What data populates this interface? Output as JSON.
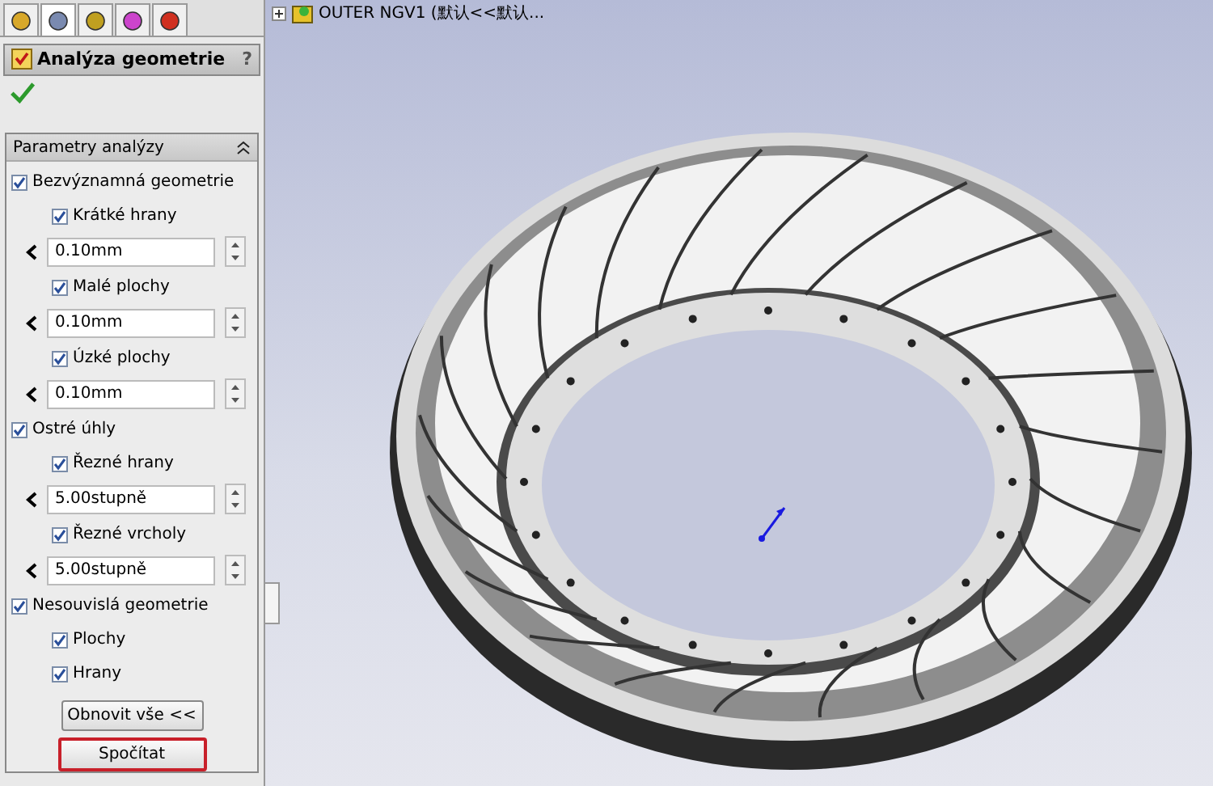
{
  "tabs": [
    {
      "selected": false
    },
    {
      "selected": true
    },
    {
      "selected": false
    },
    {
      "selected": false
    },
    {
      "selected": false
    }
  ],
  "tree": {
    "label": "OUTER NGV1 (默认<<默认..."
  },
  "panel": {
    "title": "Analýza geometrie",
    "help": "?"
  },
  "group": {
    "title": "Parametry analýzy",
    "expanded": true,
    "items": [
      {
        "label": "Bezvýznamná geometrie",
        "checked": true,
        "children": [
          {
            "kind": "checkbox",
            "label": "Krátké hrany",
            "checked": true
          },
          {
            "kind": "field",
            "value": "0.10mm"
          },
          {
            "kind": "checkbox",
            "label": "Malé plochy",
            "checked": true
          },
          {
            "kind": "field",
            "value": "0.10mm"
          },
          {
            "kind": "checkbox",
            "label": "Úzké plochy",
            "checked": true
          },
          {
            "kind": "field",
            "value": "0.10mm"
          }
        ]
      },
      {
        "label": "Ostré úhly",
        "checked": true,
        "children": [
          {
            "kind": "checkbox",
            "label": "Řezné hrany",
            "checked": true
          },
          {
            "kind": "field",
            "value": "5.00stupně"
          },
          {
            "kind": "checkbox",
            "label": "Řezné vrcholy",
            "checked": true
          },
          {
            "kind": "field",
            "value": "5.00stupně"
          }
        ]
      },
      {
        "label": "Nesouvislá geometrie",
        "checked": true,
        "children": [
          {
            "kind": "checkbox",
            "label": "Plochy",
            "checked": true
          },
          {
            "kind": "checkbox",
            "label": "Hrany",
            "checked": true
          }
        ]
      }
    ],
    "buttons": [
      {
        "label": "Obnovit vše <<",
        "highlighted": false
      },
      {
        "label": "Spočítat",
        "highlighted": true
      }
    ]
  }
}
